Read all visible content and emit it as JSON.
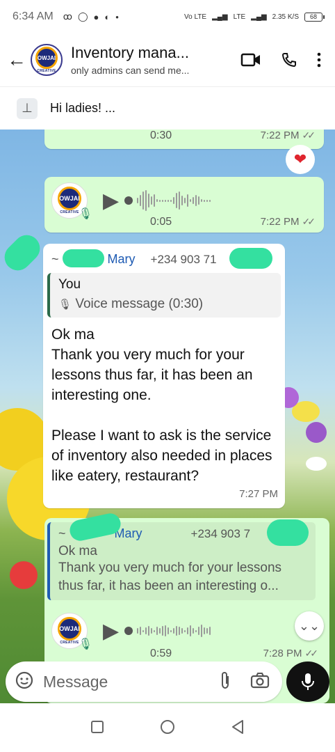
{
  "status": {
    "time": "6:34 AM",
    "network1": "Vo LTE",
    "network2": "LTE",
    "speed": "2.35 K/S",
    "battery": "68"
  },
  "header": {
    "title": "Inventory mana...",
    "subtitle": "only admins can send me...",
    "logo_text": "OWJAI",
    "logo_sub": "CREATIVE"
  },
  "pinned": {
    "text": "Hi ladies! ..."
  },
  "messages": {
    "voice1": {
      "duration": "0:30",
      "time": "7:22 PM"
    },
    "reaction": "❤",
    "voice2": {
      "duration": "0:05",
      "time": "7:22 PM"
    },
    "incoming": {
      "sender_prefix": "~",
      "sender_name": "Mary",
      "sender_phone": "+234 903 71",
      "quote_name": "You",
      "quote_text": "Voice message (0:30)",
      "body": "Ok ma\nThank you very much for your lessons thus far, it has been an interesting one.\n\nPlease I want to ask is the service of inventory also needed in places like eatery, restaurant?",
      "time": "7:27 PM"
    },
    "reply": {
      "quote_name_prefix": "~",
      "quote_name": "Mary",
      "quote_phone": "+234 903 7",
      "quote_line1": "Ok ma",
      "quote_line2": "Thank you very much for your lessons thus far, it has been an interesting o...",
      "duration": "0:59",
      "time": "7:28 PM"
    }
  },
  "composer": {
    "placeholder": "Message"
  },
  "colors": {
    "outgoing": "#d9fdd3",
    "link_name": "#1e5bb3",
    "heart": "#e0252e"
  }
}
